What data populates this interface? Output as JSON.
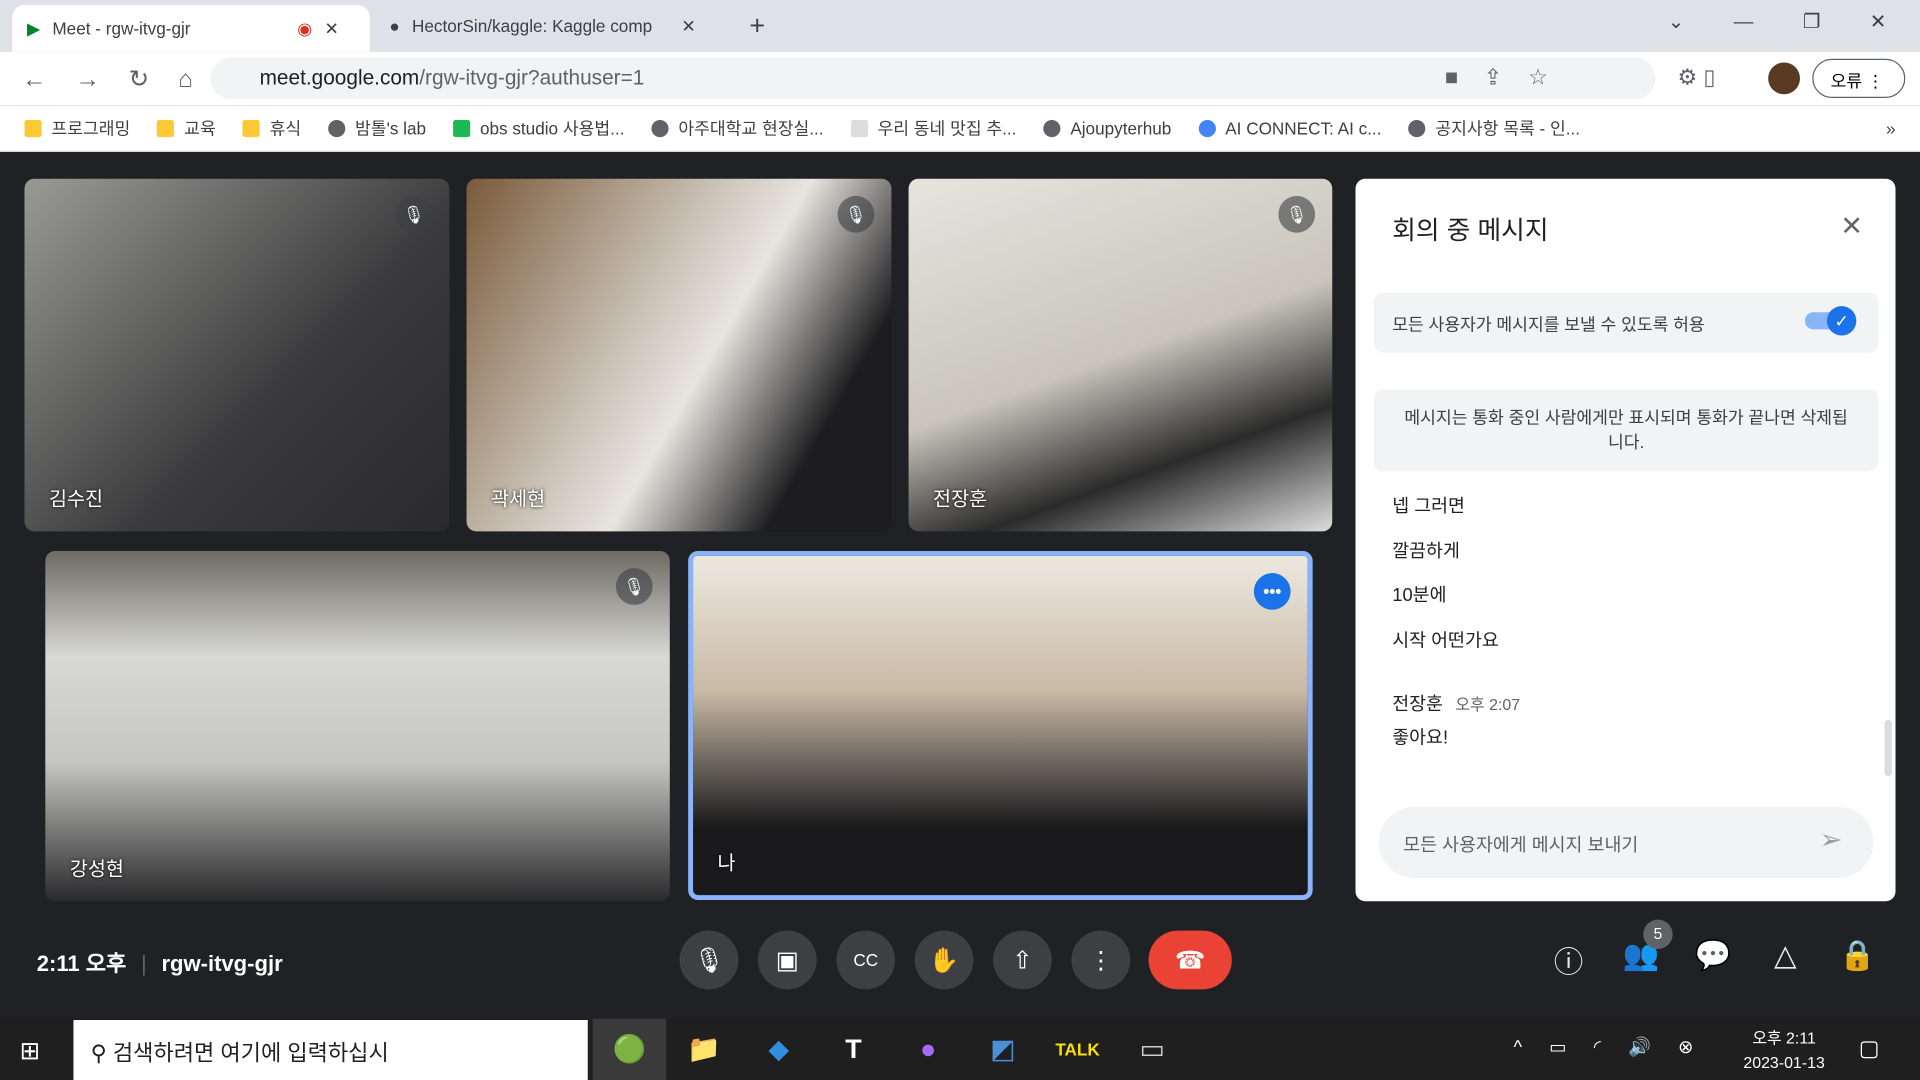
{
  "browser": {
    "tabs": [
      {
        "title": "Meet - rgw-itvg-gjr"
      },
      {
        "title": "HectorSin/kaggle: Kaggle comp"
      }
    ],
    "url_host": "meet.google.com",
    "url_path": "/rgw-itvg-gjr?authuser=1",
    "profile_label": "오류",
    "bookmarks": [
      "프로그래밍",
      "교육",
      "휴식",
      "밤톨's lab",
      "obs studio 사용법...",
      "아주대학교 현장실...",
      "우리 동네 맛집 추...",
      "Ajoupyterhub",
      "AI CONNECT: AI c...",
      "공지사항 목록 - 인..."
    ]
  },
  "participants": [
    {
      "name": "김수진",
      "muted": true
    },
    {
      "name": "곽세현",
      "muted": true
    },
    {
      "name": "전장훈",
      "muted": true
    },
    {
      "name": "강성현",
      "muted": true
    },
    {
      "name": "나",
      "muted": false
    }
  ],
  "chat": {
    "title": "회의 중 메시지",
    "allow_label": "모든 사용자가 메시지를 보낼 수 있도록 허용",
    "allow_on": true,
    "notice": "메시지는 통화 중인 사람에게만 표시되며 통화가 끝나면 삭제됩니다.",
    "messages": [
      "넵 그러면",
      "깔끔하게",
      "10분에",
      "시작 어떤가요"
    ],
    "last_sender": "전장훈",
    "last_time": "오후 2:07",
    "last_message": "좋아요!",
    "input_placeholder": "모든 사용자에게 메시지 보내기"
  },
  "meeting": {
    "time": "2:11 오후",
    "code": "rgw-itvg-gjr",
    "participant_count": "5"
  },
  "taskbar": {
    "search_placeholder": "검색하려면 여기에 입력하십시",
    "clock_time": "오후 2:11",
    "clock_date": "2023-01-13"
  }
}
